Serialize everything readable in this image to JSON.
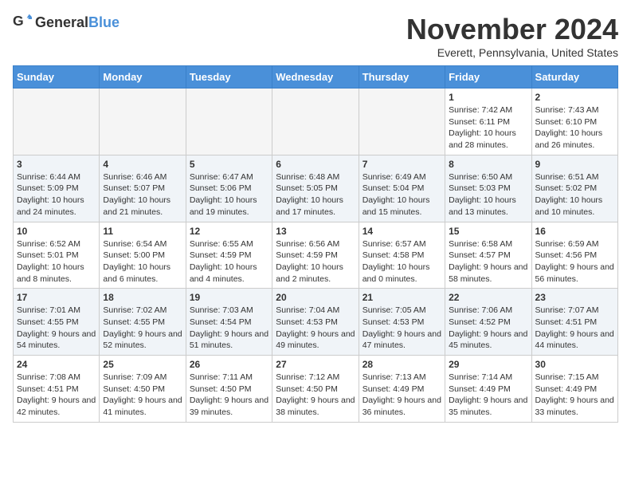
{
  "header": {
    "logo_general": "General",
    "logo_blue": "Blue",
    "month_title": "November 2024",
    "location": "Everett, Pennsylvania, United States"
  },
  "days_of_week": [
    "Sunday",
    "Monday",
    "Tuesday",
    "Wednesday",
    "Thursday",
    "Friday",
    "Saturday"
  ],
  "weeks": [
    [
      {
        "day": "",
        "empty": true
      },
      {
        "day": "",
        "empty": true
      },
      {
        "day": "",
        "empty": true
      },
      {
        "day": "",
        "empty": true
      },
      {
        "day": "",
        "empty": true
      },
      {
        "day": "1",
        "sunrise": "7:42 AM",
        "sunset": "6:11 PM",
        "daylight": "10 hours and 28 minutes."
      },
      {
        "day": "2",
        "sunrise": "7:43 AM",
        "sunset": "6:10 PM",
        "daylight": "10 hours and 26 minutes."
      }
    ],
    [
      {
        "day": "3",
        "sunrise": "6:44 AM",
        "sunset": "5:09 PM",
        "daylight": "10 hours and 24 minutes."
      },
      {
        "day": "4",
        "sunrise": "6:46 AM",
        "sunset": "5:07 PM",
        "daylight": "10 hours and 21 minutes."
      },
      {
        "day": "5",
        "sunrise": "6:47 AM",
        "sunset": "5:06 PM",
        "daylight": "10 hours and 19 minutes."
      },
      {
        "day": "6",
        "sunrise": "6:48 AM",
        "sunset": "5:05 PM",
        "daylight": "10 hours and 17 minutes."
      },
      {
        "day": "7",
        "sunrise": "6:49 AM",
        "sunset": "5:04 PM",
        "daylight": "10 hours and 15 minutes."
      },
      {
        "day": "8",
        "sunrise": "6:50 AM",
        "sunset": "5:03 PM",
        "daylight": "10 hours and 13 minutes."
      },
      {
        "day": "9",
        "sunrise": "6:51 AM",
        "sunset": "5:02 PM",
        "daylight": "10 hours and 10 minutes."
      }
    ],
    [
      {
        "day": "10",
        "sunrise": "6:52 AM",
        "sunset": "5:01 PM",
        "daylight": "10 hours and 8 minutes."
      },
      {
        "day": "11",
        "sunrise": "6:54 AM",
        "sunset": "5:00 PM",
        "daylight": "10 hours and 6 minutes."
      },
      {
        "day": "12",
        "sunrise": "6:55 AM",
        "sunset": "4:59 PM",
        "daylight": "10 hours and 4 minutes."
      },
      {
        "day": "13",
        "sunrise": "6:56 AM",
        "sunset": "4:59 PM",
        "daylight": "10 hours and 2 minutes."
      },
      {
        "day": "14",
        "sunrise": "6:57 AM",
        "sunset": "4:58 PM",
        "daylight": "10 hours and 0 minutes."
      },
      {
        "day": "15",
        "sunrise": "6:58 AM",
        "sunset": "4:57 PM",
        "daylight": "9 hours and 58 minutes."
      },
      {
        "day": "16",
        "sunrise": "6:59 AM",
        "sunset": "4:56 PM",
        "daylight": "9 hours and 56 minutes."
      }
    ],
    [
      {
        "day": "17",
        "sunrise": "7:01 AM",
        "sunset": "4:55 PM",
        "daylight": "9 hours and 54 minutes."
      },
      {
        "day": "18",
        "sunrise": "7:02 AM",
        "sunset": "4:55 PM",
        "daylight": "9 hours and 52 minutes."
      },
      {
        "day": "19",
        "sunrise": "7:03 AM",
        "sunset": "4:54 PM",
        "daylight": "9 hours and 51 minutes."
      },
      {
        "day": "20",
        "sunrise": "7:04 AM",
        "sunset": "4:53 PM",
        "daylight": "9 hours and 49 minutes."
      },
      {
        "day": "21",
        "sunrise": "7:05 AM",
        "sunset": "4:53 PM",
        "daylight": "9 hours and 47 minutes."
      },
      {
        "day": "22",
        "sunrise": "7:06 AM",
        "sunset": "4:52 PM",
        "daylight": "9 hours and 45 minutes."
      },
      {
        "day": "23",
        "sunrise": "7:07 AM",
        "sunset": "4:51 PM",
        "daylight": "9 hours and 44 minutes."
      }
    ],
    [
      {
        "day": "24",
        "sunrise": "7:08 AM",
        "sunset": "4:51 PM",
        "daylight": "9 hours and 42 minutes."
      },
      {
        "day": "25",
        "sunrise": "7:09 AM",
        "sunset": "4:50 PM",
        "daylight": "9 hours and 41 minutes."
      },
      {
        "day": "26",
        "sunrise": "7:11 AM",
        "sunset": "4:50 PM",
        "daylight": "9 hours and 39 minutes."
      },
      {
        "day": "27",
        "sunrise": "7:12 AM",
        "sunset": "4:50 PM",
        "daylight": "9 hours and 38 minutes."
      },
      {
        "day": "28",
        "sunrise": "7:13 AM",
        "sunset": "4:49 PM",
        "daylight": "9 hours and 36 minutes."
      },
      {
        "day": "29",
        "sunrise": "7:14 AM",
        "sunset": "4:49 PM",
        "daylight": "9 hours and 35 minutes."
      },
      {
        "day": "30",
        "sunrise": "7:15 AM",
        "sunset": "4:49 PM",
        "daylight": "9 hours and 33 minutes."
      }
    ]
  ]
}
